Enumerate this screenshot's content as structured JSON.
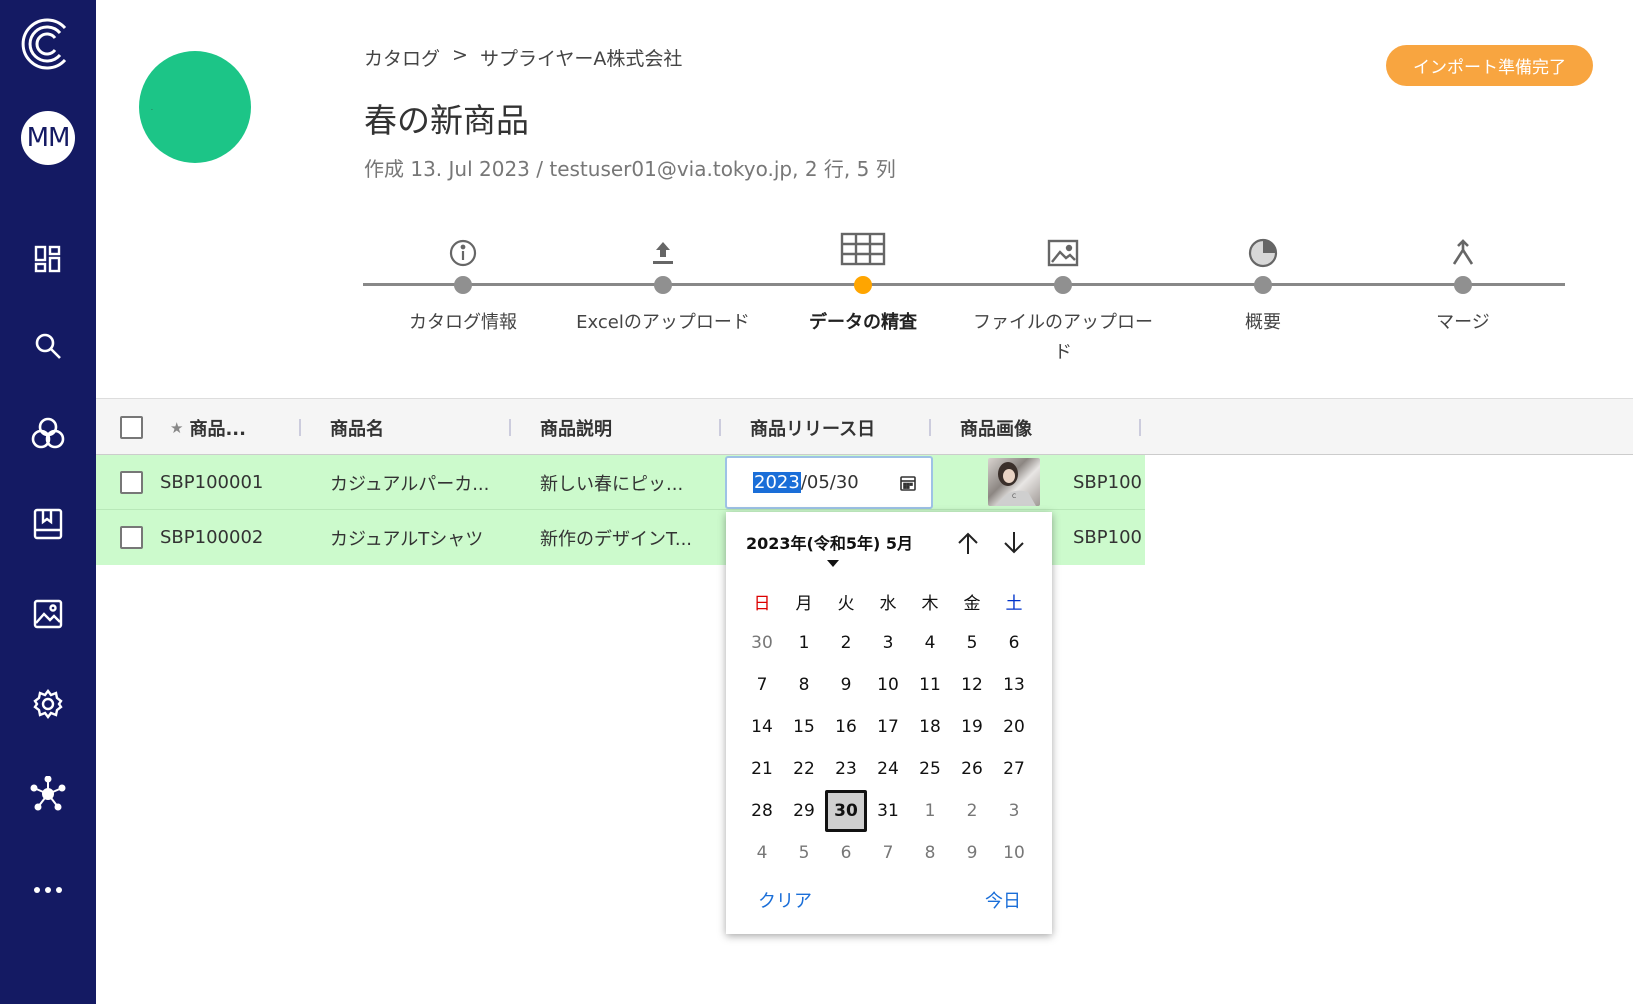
{
  "sidebar": {
    "avatar_initials": "MM",
    "items": [
      "dashboard-icon",
      "search-icon",
      "connections-icon",
      "catalog-book-icon",
      "image-icon",
      "gear-icon",
      "network-icon",
      "more-icon"
    ]
  },
  "header": {
    "breadcrumb": [
      "カタログ",
      ">",
      "サプライヤーA株式会社"
    ],
    "title": "春の新商品",
    "meta": "作成 13. Jul 2023 / testuser01@via.tokyo.jp, 2 行, 5 列",
    "import_button": "インポート準備完了",
    "accent_color": "#f8a540"
  },
  "stepper": {
    "steps": [
      {
        "label": "カタログ情報",
        "icon": "info-icon"
      },
      {
        "label": "Excelのアップロード",
        "icon": "upload-icon"
      },
      {
        "label": "データの精査",
        "icon": "table-icon"
      },
      {
        "label": "ファイルのアップロー",
        "label2": "ド",
        "icon": "image-file-icon"
      },
      {
        "label": "概要",
        "icon": "pie-chart-icon"
      },
      {
        "label": "マージ",
        "icon": "merge-icon"
      }
    ],
    "active_index": 2
  },
  "table": {
    "columns": [
      "商品...",
      "商品名",
      "商品説明",
      "商品リリース日",
      "商品画像"
    ],
    "key_marker": "★",
    "rows": [
      {
        "id": "SBP100001",
        "name": "カジュアルパーカ...",
        "desc": "新しい春にピッ...",
        "extra": "SBP100"
      },
      {
        "id": "SBP100002",
        "name": "カジュアルTシャツ",
        "desc": "新作のデザインT...",
        "extra": "SBP100"
      }
    ]
  },
  "date_input": {
    "year": "2023",
    "rest": "/05/30"
  },
  "calendar": {
    "title": "2023年(令和5年) 5月",
    "weekdays": [
      "日",
      "月",
      "火",
      "水",
      "木",
      "金",
      "土"
    ],
    "weeks": [
      [
        "30",
        "1",
        "2",
        "3",
        "4",
        "5",
        "6"
      ],
      [
        "7",
        "8",
        "9",
        "10",
        "11",
        "12",
        "13"
      ],
      [
        "14",
        "15",
        "16",
        "17",
        "18",
        "19",
        "20"
      ],
      [
        "21",
        "22",
        "23",
        "24",
        "25",
        "26",
        "27"
      ],
      [
        "28",
        "29",
        "30",
        "31",
        "1",
        "2",
        "3"
      ],
      [
        "4",
        "5",
        "6",
        "7",
        "8",
        "9",
        "10"
      ]
    ],
    "clear_label": "クリア",
    "today_label": "今日"
  }
}
